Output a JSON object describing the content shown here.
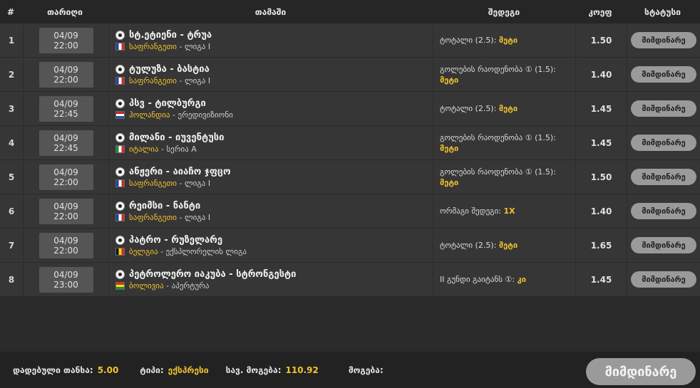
{
  "header": {
    "num": "#",
    "date": "თარიღი",
    "match": "თამაში",
    "market": "შედეგი",
    "odd": "კოეფ",
    "status": "სტატუსი"
  },
  "rows": [
    {
      "num": "1",
      "date": "04/09 22:00",
      "teams": "სტ.ეტიენი - ტრუა",
      "flag": "fr",
      "country": "საფრანგეთი",
      "league": "ლიგა I",
      "market": "ტოტალი (2.5):",
      "pick": "მეტი",
      "odd": "1.50",
      "status": "მიმდინარე"
    },
    {
      "num": "2",
      "date": "04/09 22:00",
      "teams": "ტულუზა - ბასტია",
      "flag": "fr",
      "country": "საფრანგეთი",
      "league": "ლიგა I",
      "market": "გოლების რაოდენობა ① (1.5):",
      "pick": "მეტი",
      "odd": "1.40",
      "status": "მიმდინარე"
    },
    {
      "num": "3",
      "date": "04/09 22:45",
      "teams": "პსვ - ტილბურგი",
      "flag": "nl",
      "country": "ჰოლანდია",
      "league": "ერედივიზიონი",
      "market": "ტოტალი (2.5):",
      "pick": "მეტი",
      "odd": "1.45",
      "status": "მიმდინარე"
    },
    {
      "num": "4",
      "date": "04/09 22:45",
      "teams": "მილანი - იუვენტუსი",
      "flag": "it",
      "country": "იტალია",
      "league": "სერია A",
      "market": "გოლების რაოდენობა ① (1.5):",
      "pick": "მეტი",
      "odd": "1.45",
      "status": "მიმდინარე"
    },
    {
      "num": "5",
      "date": "04/09 22:00",
      "teams": "ანჟერი - აიაჩო ჯფცო",
      "flag": "fr",
      "country": "საფრანგეთი",
      "league": "ლიგა I",
      "market": "გოლების რაოდენობა ① (1.5):",
      "pick": "მეტი",
      "odd": "1.50",
      "status": "მიმდინარე"
    },
    {
      "num": "6",
      "date": "04/09 22:00",
      "teams": "რეიმსი - ნანტი",
      "flag": "fr",
      "country": "საფრანგეთი",
      "league": "ლიგა I",
      "market": "ორმაგი შედეგი:",
      "pick": "1X",
      "odd": "1.40",
      "status": "მიმდინარე"
    },
    {
      "num": "7",
      "date": "04/09 22:00",
      "teams": "პატრო - რუზელარე",
      "flag": "be",
      "country": "ბელგია",
      "league": "ექსპლორელის ლიგა",
      "market": "ტოტალი (2.5):",
      "pick": "მეტი",
      "odd": "1.65",
      "status": "მიმდინარე"
    },
    {
      "num": "8",
      "date": "04/09 23:00",
      "teams": "პეტროლერო იაკუბა - სტრონგესტი",
      "flag": "bo",
      "country": "ბოლივია",
      "league": "აპერტურა",
      "market": "II გუნდი გაიტანს ①:",
      "pick": "კი",
      "odd": "1.45",
      "status": "მიმდინარე"
    }
  ],
  "footer": {
    "stake_label": "დადებული თანხა:",
    "stake_value": "5.00",
    "type_label": "ტიპი:",
    "type_value": "ექსპრესი",
    "potential_label": "სავ. მოგება:",
    "potential_value": "110.92",
    "win_label": "მოგება:",
    "status_button": "მიმდინარე"
  }
}
